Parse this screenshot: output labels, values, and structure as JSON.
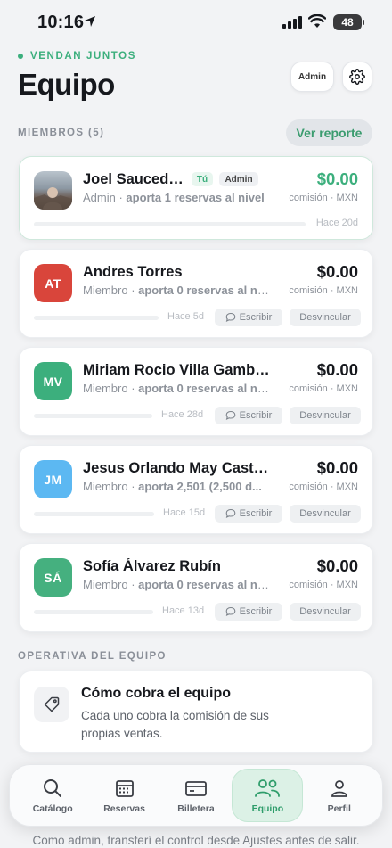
{
  "status_bar": {
    "time": "10:16",
    "battery": "48"
  },
  "header": {
    "brand": "VENDAN JUNTOS",
    "title": "Equipo",
    "admin_label": "Admin"
  },
  "members_section": {
    "label": "MIEMBROS (5)",
    "report_button": "Ver reporte"
  },
  "members": [
    {
      "initials": "",
      "name": "Joel Saucedo...",
      "you_badge": "Tú",
      "admin_badge": "Admin",
      "role": "Admin",
      "contribution": "aporta 1 reservas al nivel",
      "amount": "$0.00",
      "amount_sub": "comisión · MXN",
      "progress": 0,
      "ago": "Hace 20d",
      "accent": "#3caf7d"
    },
    {
      "initials": "AT",
      "name": "Andres Torres",
      "role": "Miembro",
      "contribution": "aporta 0 reservas al ni...",
      "amount": "$0.00",
      "amount_sub": "comisión · MXN",
      "progress": 0,
      "ago": "Hace 5d",
      "write_label": "Escribir",
      "unlink_label": "Desvincular",
      "color": "#d9453b"
    },
    {
      "initials": "MV",
      "name": "Miriam Rocio Villa Gamboa",
      "role": "Miembro",
      "contribution": "aporta 0 reservas al ni...",
      "amount": "$0.00",
      "amount_sub": "comisión · MXN",
      "progress": 0,
      "ago": "Hace 28d",
      "write_label": "Escribir",
      "unlink_label": "Desvincular",
      "color": "#3caf7d"
    },
    {
      "initials": "JM",
      "name": "Jesus Orlando  May Castillo",
      "role": "Miembro",
      "contribution": "aporta 2,501 (2,500 d...",
      "amount": "$0.00",
      "amount_sub": "comisión · MXN",
      "progress": 0,
      "ago": "Hace 15d",
      "write_label": "Escribir",
      "unlink_label": "Desvincular",
      "color": "#5cb8f2"
    },
    {
      "initials": "SÁ",
      "name": "Sofía Álvarez Rubín",
      "role": "Miembro",
      "contribution": "aporta 0 reservas al ni...",
      "amount": "$0.00",
      "amount_sub": "comisión · MXN",
      "progress": 0,
      "ago": "Hace 13d",
      "write_label": "Escribir",
      "unlink_label": "Desvincular",
      "color": "#45b07f"
    }
  ],
  "ops_section": {
    "label": "OPERATIVA DEL EQUIPO",
    "title": "Cómo cobra el equipo",
    "description": "Cada uno cobra la comisión de sus propias ventas."
  },
  "footer_note": "Como admin, transferí el control desde Ajustes antes de salir.",
  "tabs": [
    {
      "label": "Catálogo",
      "icon": "search-icon"
    },
    {
      "label": "Reservas",
      "icon": "calendar-icon"
    },
    {
      "label": "Billetera",
      "icon": "wallet-icon"
    },
    {
      "label": "Equipo",
      "icon": "team-icon",
      "active": true
    },
    {
      "label": "Perfil",
      "icon": "user-icon"
    }
  ]
}
